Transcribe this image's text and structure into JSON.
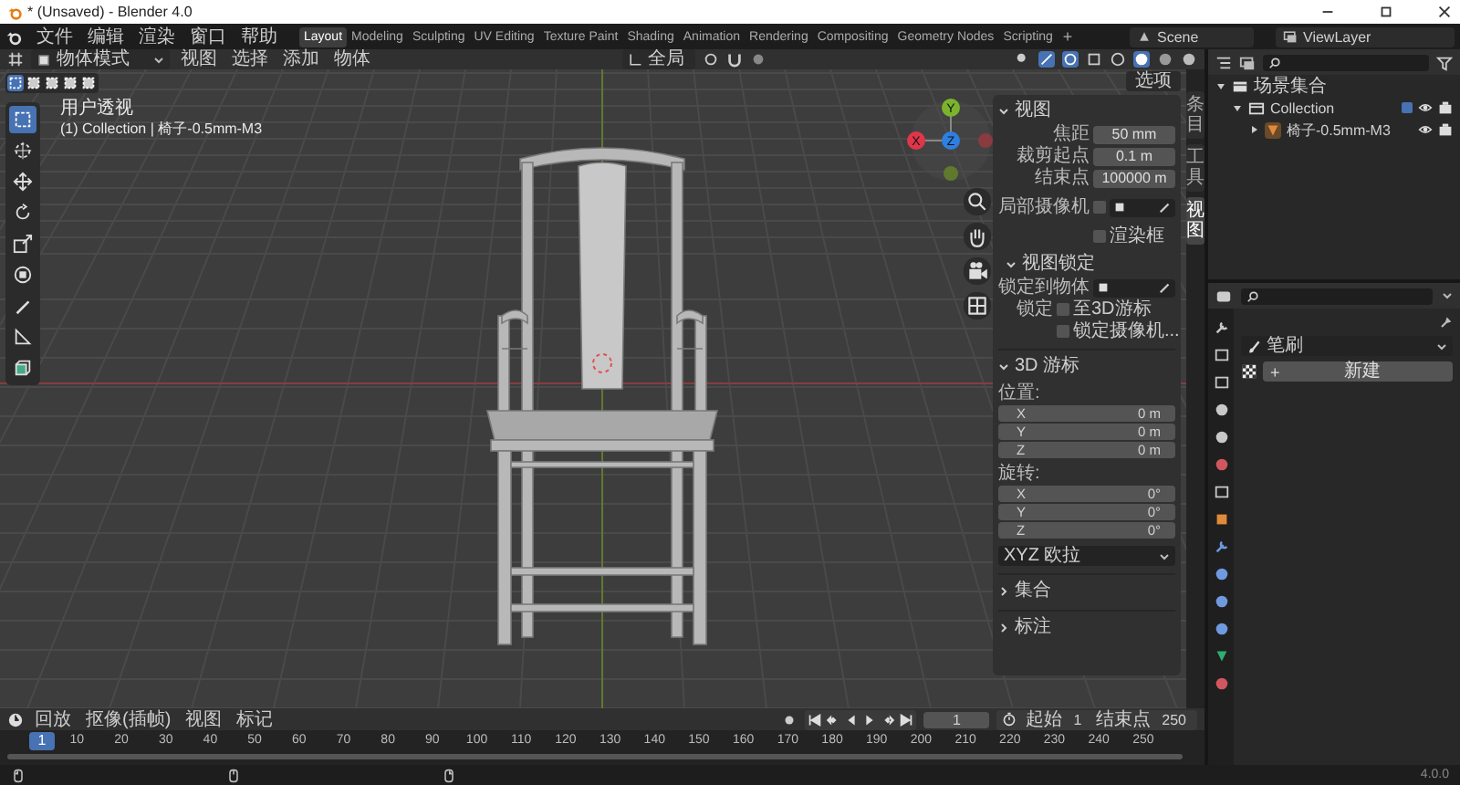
{
  "window": {
    "title": "* (Unsaved) - Blender 4.0"
  },
  "menu": [
    "文件",
    "编辑",
    "渲染",
    "窗口",
    "帮助"
  ],
  "workspaces": [
    {
      "label": "Layout",
      "selected": true
    },
    {
      "label": "Modeling",
      "selected": false
    },
    {
      "label": "Sculpting",
      "selected": false
    },
    {
      "label": "UV Editing",
      "selected": false
    },
    {
      "label": "Texture Paint",
      "selected": false
    },
    {
      "label": "Shading",
      "selected": false
    },
    {
      "label": "Animation",
      "selected": false
    },
    {
      "label": "Rendering",
      "selected": false
    },
    {
      "label": "Compositing",
      "selected": false
    },
    {
      "label": "Geometry Nodes",
      "selected": false
    },
    {
      "label": "Scripting",
      "selected": false
    }
  ],
  "add_workspace": "+",
  "scene": "Scene",
  "view_layer": "ViewLayer",
  "viewport_header": {
    "mode": "物体模式",
    "menus": [
      "视图",
      "选择",
      "添加",
      "物体"
    ],
    "orientation": "全局",
    "options_button": "选项"
  },
  "toolbar": [
    {
      "kind": "select",
      "selected": true
    },
    {
      "kind": "cursor",
      "selected": false
    },
    {
      "kind": "move",
      "selected": false
    },
    {
      "kind": "rotate",
      "selected": false
    },
    {
      "kind": "scale",
      "selected": false
    },
    {
      "kind": "transform",
      "selected": false
    },
    {
      "kind": "annotate",
      "selected": false
    },
    {
      "kind": "measure",
      "selected": false
    },
    {
      "kind": "add_cube",
      "selected": false
    }
  ],
  "viewport": {
    "view_name": "用户透视",
    "context": "(1) Collection | 椅子-0.5mm-M3",
    "gizmo": [
      "Y",
      "X",
      "Z"
    ]
  },
  "sidebar": {
    "tabs": [
      {
        "label": "条目",
        "selected": false
      },
      {
        "label": "工具",
        "selected": false
      },
      {
        "label": "视图",
        "selected": true
      }
    ],
    "view_panel": {
      "title": "视图",
      "expanded": true,
      "fields": [
        {
          "label": "焦距",
          "value": "50 mm"
        },
        {
          "label": "裁剪起点",
          "value": "0.1 m"
        },
        {
          "label": "结束点",
          "value": "100000 m"
        }
      ],
      "local_camera": {
        "label": "局部摄像机",
        "checked": false
      },
      "render_region": {
        "label": "渲染框",
        "checked": false
      },
      "lock": {
        "title": "视图锁定",
        "expanded": true,
        "object_label": "锁定到物体",
        "lock_label": "锁定",
        "options": [
          {
            "label": "至3D游标",
            "checked": false
          },
          {
            "label": "锁定摄像机...",
            "checked": false
          }
        ]
      }
    },
    "cursor_panel": {
      "title": "3D 游标",
      "expanded": true,
      "location_label": "位置:",
      "location": [
        {
          "axis": "X",
          "value": "0 m"
        },
        {
          "axis": "Y",
          "value": "0 m"
        },
        {
          "axis": "Z",
          "value": "0 m"
        }
      ],
      "rotation_label": "旋转:",
      "rotation": [
        {
          "axis": "X",
          "value": "0°"
        },
        {
          "axis": "Y",
          "value": "0°"
        },
        {
          "axis": "Z",
          "value": "0°"
        }
      ],
      "rotation_mode": "XYZ 欧拉"
    },
    "collapsed_panels": [
      {
        "title": "集合",
        "expanded": false
      },
      {
        "title": "标注",
        "expanded": false
      }
    ]
  },
  "outliner": {
    "tree": [
      {
        "label": "场景集合",
        "kind": "scene",
        "expanded": true,
        "children": [
          {
            "label": "Collection",
            "kind": "collection",
            "expanded": true,
            "checked": true,
            "children": [
              {
                "label": "椅子-0.5mm-M3",
                "kind": "mesh",
                "expanded": false
              }
            ]
          }
        ]
      }
    ]
  },
  "properties": {
    "brush": "笔刷",
    "new_icon": "+",
    "new_button": "新建"
  },
  "timeline": {
    "menus": [
      "回放",
      "抠像(插帧)",
      "视图",
      "标记"
    ],
    "current_frame": "1",
    "start_label": "起始",
    "start": "1",
    "end_label": "结束点",
    "end": "250",
    "playhead": "1",
    "ticks": [
      "10",
      "20",
      "30",
      "40",
      "50",
      "60",
      "70",
      "80",
      "90",
      "100",
      "110",
      "120",
      "130",
      "140",
      "150",
      "160",
      "170",
      "180",
      "190",
      "200",
      "210",
      "220",
      "230",
      "240",
      "250"
    ]
  },
  "status_bar": {
    "version": "4.0.0"
  }
}
